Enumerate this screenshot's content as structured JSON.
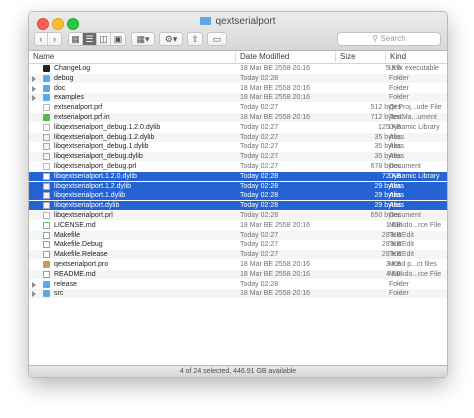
{
  "window": {
    "title": "qextserialport"
  },
  "toolbar": {
    "back_icon": "chevron-left-icon",
    "forward_icon": "chevron-right-icon",
    "view_icons": [
      "grid-icon",
      "list-icon",
      "columns-icon",
      "gallery-icon"
    ],
    "arrange_icon": "arrange-grid-icon",
    "action_icon": "gear-icon",
    "share_icon": "share-icon",
    "tag_icon": "tag-icon",
    "search_placeholder": "Search"
  },
  "columns": {
    "name": "Name",
    "date": "Date Modified",
    "size": "Size",
    "kind": "Kind"
  },
  "files": [
    {
      "name": "ChangeLog",
      "date": "18 Mar BE 2558 20:16",
      "size": "5 KB",
      "kind": "Unix executable",
      "icon": "exec",
      "folder": false,
      "selected": false
    },
    {
      "name": "debug",
      "date": "Today 02:28",
      "size": "--",
      "kind": "Folder",
      "icon": "folder",
      "folder": true,
      "selected": false
    },
    {
      "name": "doc",
      "date": "18 Mar BE 2558 20:16",
      "size": "--",
      "kind": "Folder",
      "icon": "folder",
      "folder": true,
      "selected": false
    },
    {
      "name": "examples",
      "date": "18 Mar BE 2558 20:16",
      "size": "--",
      "kind": "Folder",
      "icon": "folder",
      "folder": true,
      "selected": false
    },
    {
      "name": "extserialport.prf",
      "date": "Today 02:27",
      "size": "512 bytes",
      "kind": "Qt Proj...ude File",
      "icon": "file",
      "folder": false,
      "selected": false
    },
    {
      "name": "extserialport.prf.in",
      "date": "18 Mar BE 2558 20:16",
      "size": "712 bytes",
      "kind": "TextMa...ument",
      "icon": "qt",
      "folder": false,
      "selected": false
    },
    {
      "name": "libqextserialport_debug.1.2.0.dylib",
      "date": "Today 02:27",
      "size": "125 KB",
      "kind": "Dynamic Library",
      "icon": "file",
      "folder": false,
      "selected": false
    },
    {
      "name": "libqextserialport_debug.1.2.dylib",
      "date": "Today 02:27",
      "size": "35 bytes",
      "kind": "Alias",
      "icon": "alias",
      "folder": false,
      "selected": false
    },
    {
      "name": "libqextserialport_debug.1.dylib",
      "date": "Today 02:27",
      "size": "35 bytes",
      "kind": "Alias",
      "icon": "alias",
      "folder": false,
      "selected": false
    },
    {
      "name": "libqextserialport_debug.dylib",
      "date": "Today 02:27",
      "size": "35 bytes",
      "kind": "Alias",
      "icon": "alias",
      "folder": false,
      "selected": false
    },
    {
      "name": "libqextserialport_debug.prl",
      "date": "Today 02:27",
      "size": "678 bytes",
      "kind": "Document",
      "icon": "file",
      "folder": false,
      "selected": false
    },
    {
      "name": "libqextserialport.1.2.0.dylib",
      "date": "Today 02:28",
      "size": "72 KB",
      "kind": "Dynamic Library",
      "icon": "file",
      "folder": false,
      "selected": true
    },
    {
      "name": "libqextserialport.1.2.dylib",
      "date": "Today 02:28",
      "size": "29 bytes",
      "kind": "Alias",
      "icon": "alias",
      "folder": false,
      "selected": true
    },
    {
      "name": "libqextserialport.1.dylib",
      "date": "Today 02:28",
      "size": "29 bytes",
      "kind": "Alias",
      "icon": "alias",
      "folder": false,
      "selected": true
    },
    {
      "name": "libqextserialport.dylib",
      "date": "Today 02:28",
      "size": "29 bytes",
      "kind": "Alias",
      "icon": "alias",
      "folder": false,
      "selected": true
    },
    {
      "name": "libqextserialport.prl",
      "date": "Today 02:28",
      "size": "650 bytes",
      "kind": "Document",
      "icon": "file",
      "folder": false,
      "selected": false
    },
    {
      "name": "LICENSE.md",
      "date": "18 Mar BE 2558 20:16",
      "size": "1 KB",
      "kind": "Markdo...rce File",
      "icon": "md",
      "folder": false,
      "selected": false
    },
    {
      "name": "Makefile",
      "date": "Today 02:27",
      "size": "28 KB",
      "kind": "TextEdit",
      "icon": "text",
      "folder": false,
      "selected": false
    },
    {
      "name": "Makefile.Debug",
      "date": "Today 02:27",
      "size": "28 KB",
      "kind": "TextEdit",
      "icon": "text",
      "folder": false,
      "selected": false
    },
    {
      "name": "Makefile.Release",
      "date": "Today 02:27",
      "size": "28 KB",
      "kind": "TextEdit",
      "icon": "text",
      "folder": false,
      "selected": false
    },
    {
      "name": "qextserialport.pro",
      "date": "18 Mar BE 2558 20:16",
      "size": "3 KB",
      "kind": "kicad p...ct files",
      "icon": "kicad",
      "folder": false,
      "selected": false
    },
    {
      "name": "README.md",
      "date": "18 Mar BE 2558 20:16",
      "size": "4 KB",
      "kind": "Markdo...rce File",
      "icon": "md",
      "folder": false,
      "selected": false
    },
    {
      "name": "release",
      "date": "Today 02:28",
      "size": "--",
      "kind": "Folder",
      "icon": "folder",
      "folder": true,
      "selected": false
    },
    {
      "name": "src",
      "date": "18 Mar BE 2558 20:16",
      "size": "--",
      "kind": "Folder",
      "icon": "folder",
      "folder": true,
      "selected": false
    }
  ],
  "status": {
    "text": "4 of 24 selected, 446.91 GB available"
  },
  "colors": {
    "selection": "#2463d1",
    "folder": "#5fa8e8",
    "close": "#fc5f57",
    "minimize": "#fdbc2e",
    "zoom": "#28c840"
  }
}
